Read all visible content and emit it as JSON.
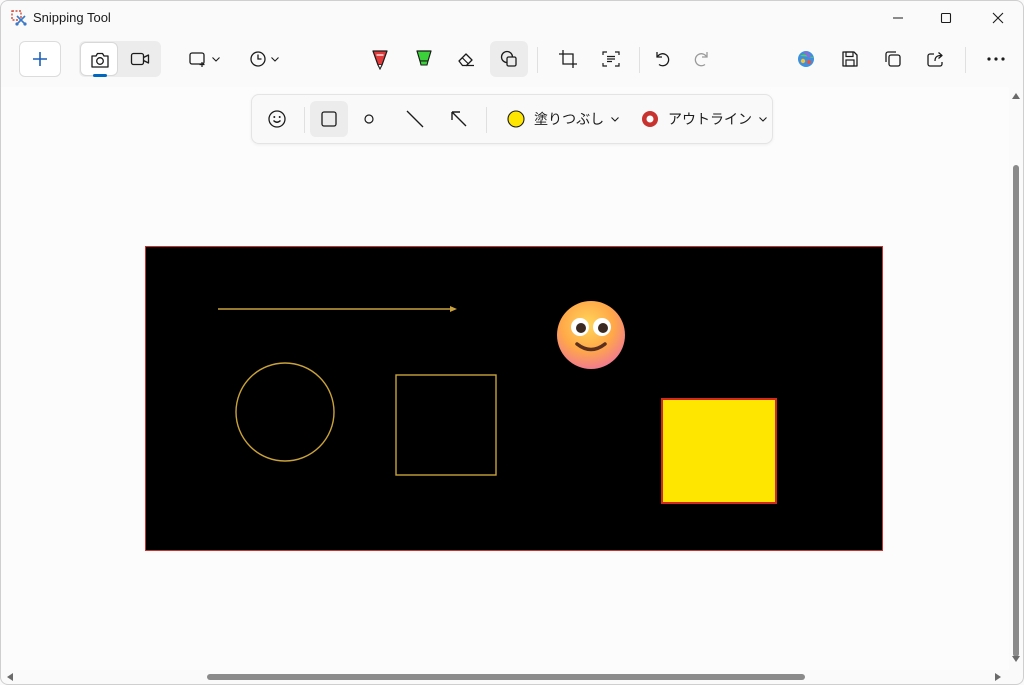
{
  "window": {
    "title": "Snipping Tool"
  },
  "toolbar": {
    "new_button": "New",
    "modes": [
      "screenshot-mode",
      "video-mode"
    ],
    "snip_shape": "rectangle-snip",
    "delay": "timer"
  },
  "shapes_panel": {
    "fill_label": "塗りつぶし",
    "fill_color": "#ffe600",
    "outline_label": "アウトライン",
    "outline_color": "#c8332f"
  },
  "canvas": {
    "background": "#000000",
    "stroke_color": "#c9a23a",
    "rect_fill": "#ffe600",
    "rect_outline": "#d6291e",
    "emoji": "smiling-face-emoji"
  }
}
